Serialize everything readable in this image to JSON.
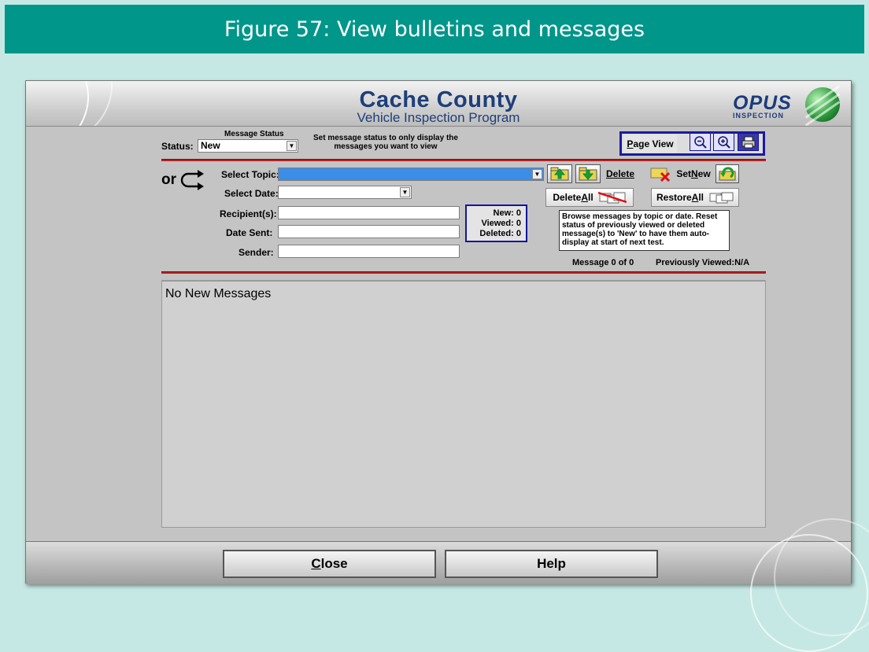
{
  "figure_caption": "Figure 57: View bulletins and messages",
  "app": {
    "title": "Cache County",
    "subtitle": "Vehicle Inspection Program",
    "logo_name": "OPUS",
    "logo_sub": "INSPECTION"
  },
  "status_bar": {
    "message_status_label": "Message Status",
    "status_label": "Status:",
    "status_value": "New",
    "hint": "Set message status to only display the messages you want to view",
    "page_view": {
      "pre": "",
      "underlined": "P",
      "post": "age View"
    }
  },
  "filters": {
    "or_label": "or",
    "select_topic_label": "Select Topic:",
    "select_topic_value": "",
    "select_date_label": "Select Date:",
    "select_date_value": "",
    "recipients_label": "Recipient(s):",
    "recipients_value": "",
    "date_sent_label": "Date Sent:",
    "date_sent_value": "",
    "sender_label": "Sender:",
    "sender_value": ""
  },
  "counts": {
    "new_label": "New:",
    "new_value": "0",
    "viewed_label": "Viewed:",
    "viewed_value": "0",
    "deleted_label": "Deleted:",
    "deleted_value": "0"
  },
  "actions": {
    "delete": "Delete",
    "set_new": {
      "pre": "Set ",
      "underlined": "N",
      "post": "ew"
    },
    "delete_all": {
      "pre": "Delete ",
      "underlined": "A",
      "post": "ll"
    },
    "restore_all": {
      "pre": "Restore ",
      "underlined": "A",
      "post": "ll"
    }
  },
  "tooltip": "Browse messages by topic or date. Reset status of previously viewed or deleted message(s) to 'New' to have them auto-display at start of next test.",
  "message_counter": "Message 0 of 0",
  "previously_viewed_label": "Previously Viewed:",
  "previously_viewed_value": "N/A",
  "message_body": "No New Messages",
  "footer": {
    "close": {
      "pre": "",
      "underlined": "C",
      "post": "lose"
    },
    "help": "Help"
  },
  "colors": {
    "accent_teal": "#00968a",
    "frame_navy": "#1a1aa0",
    "divider_red": "#b32222",
    "topic_highlight": "#3b8de8"
  },
  "icons": [
    "circular-arrow-icon",
    "zoom-out-icon",
    "zoom-in-icon",
    "print-icon",
    "folder-up-icon",
    "folder-down-icon",
    "delete-envelope-icon",
    "reset-arrow-icon",
    "crossed-envelopes-icon",
    "envelopes-icon"
  ]
}
